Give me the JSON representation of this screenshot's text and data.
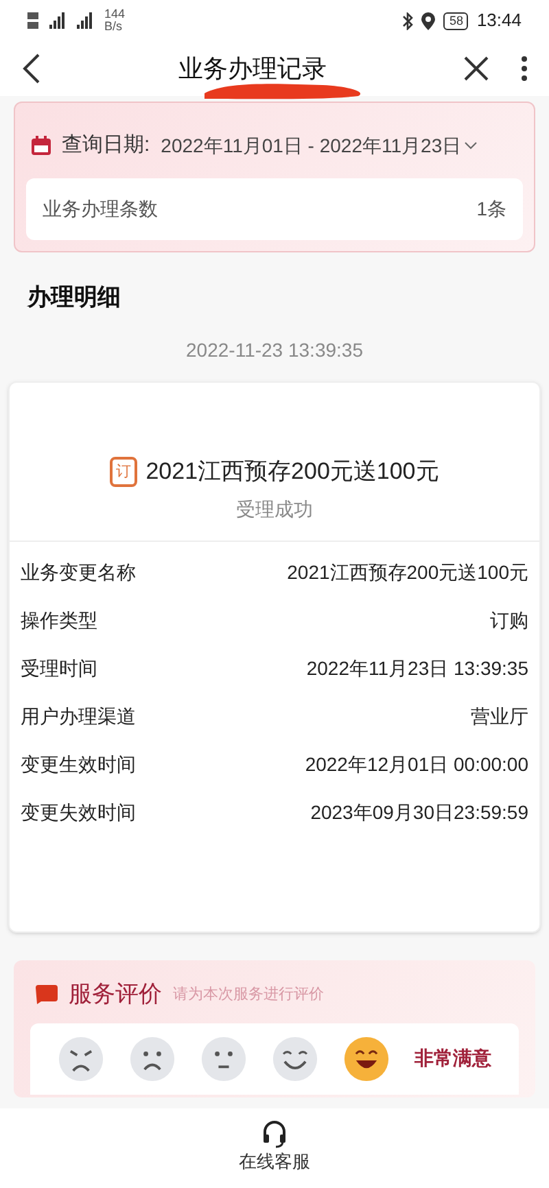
{
  "status_bar": {
    "speed_value": "144",
    "speed_unit": "B/s",
    "battery": "58",
    "time": "13:44"
  },
  "header": {
    "title": "业务办理记录",
    "redacted": true
  },
  "query": {
    "label": "查询日期:",
    "range": "2022年11月01日 - 2022年11月23日",
    "count_label": "业务办理条数",
    "count": "1条"
  },
  "section_title": "办理明细",
  "timestamp": "2022-11-23 13:39:35",
  "detail": {
    "badge": "订",
    "name": "2021江西预存200元送100元",
    "status": "受理成功",
    "rows": [
      {
        "label": "业务变更名称",
        "value": "2021江西预存200元送100元"
      },
      {
        "label": "操作类型",
        "value": "订购"
      },
      {
        "label": "受理时间",
        "value": "2022年11月23日 13:39:35"
      },
      {
        "label": "用户办理渠道",
        "value": "营业厅"
      },
      {
        "label": "变更生效时间",
        "value": "2022年12月01日 00:00:00"
      },
      {
        "label": "变更失效时间",
        "value": "2023年09月30日23:59:59"
      }
    ]
  },
  "rating": {
    "title": "服务评价",
    "hint": "请为本次服务进行评价",
    "selected_label": "非常满意",
    "faces": [
      {
        "kind": "angry",
        "selected": false
      },
      {
        "kind": "sad",
        "selected": false
      },
      {
        "kind": "neutral",
        "selected": false
      },
      {
        "kind": "smile",
        "selected": false
      },
      {
        "kind": "laugh",
        "selected": true
      }
    ]
  },
  "bottom": {
    "label": "在线客服"
  }
}
